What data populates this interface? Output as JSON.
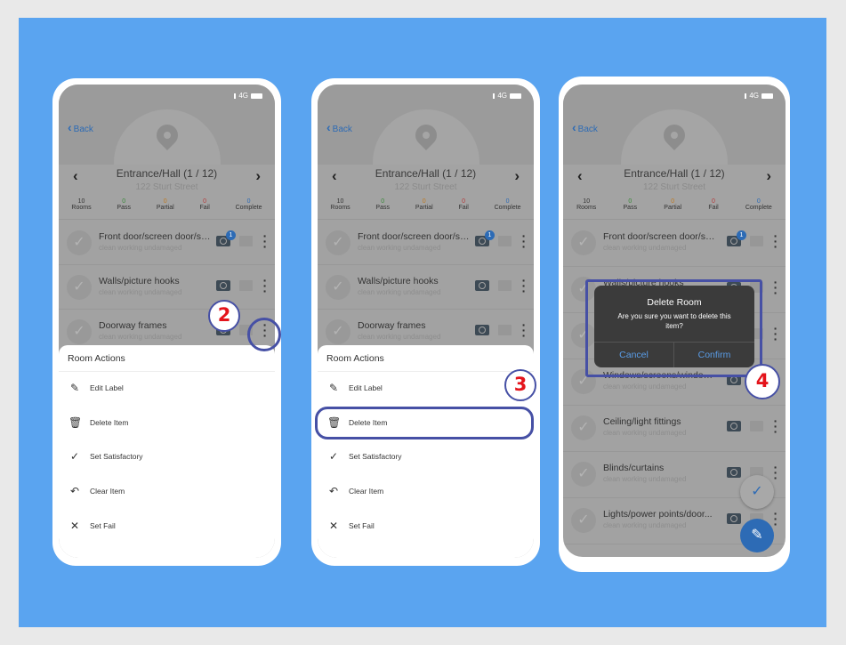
{
  "status": {
    "network": "4G"
  },
  "header": {
    "back_label": "Back",
    "title": "Entrance/Hall (1 / 12)",
    "address": "122 Sturt Street",
    "prev_icon": "chevron-left",
    "next_icon": "chevron-right"
  },
  "stats": [
    {
      "value": "10",
      "label": "Rooms",
      "color": "#333333"
    },
    {
      "value": "0",
      "label": "Pass",
      "color": "#3a8a3a"
    },
    {
      "value": "0",
      "label": "Partial",
      "color": "#c07a20"
    },
    {
      "value": "0",
      "label": "Fail",
      "color": "#b53a3a"
    },
    {
      "value": "0",
      "label": "Complete",
      "color": "#2d6bb5"
    }
  ],
  "items": [
    {
      "title": "Front door/screen door/se...",
      "subtitle": "clean working undamaged",
      "photo_count": "1"
    },
    {
      "title": "Walls/picture hooks",
      "subtitle": "clean working undamaged"
    },
    {
      "title": "Doorway frames",
      "subtitle": "clean working undamaged"
    },
    {
      "title": "Windows/screens/window...",
      "subtitle": "clean working undamaged"
    },
    {
      "title": "Ceiling/light fittings",
      "subtitle": "clean working undamaged"
    },
    {
      "title": "Blinds/curtains",
      "subtitle": "clean working undamaged"
    },
    {
      "title": "Lights/power points/door...",
      "subtitle": "clean working undamaged"
    }
  ],
  "room_actions": {
    "title": "Room Actions",
    "items": [
      {
        "label": "Edit Label",
        "icon": "pencil-icon",
        "glyph": "✎"
      },
      {
        "label": "Delete Item",
        "icon": "trash-icon",
        "glyph": "🗑"
      },
      {
        "label": "Set Satisfactory",
        "icon": "check-icon",
        "glyph": "✓"
      },
      {
        "label": "Clear Item",
        "icon": "undo-icon",
        "glyph": "↶"
      },
      {
        "label": "Set Fail",
        "icon": "close-icon",
        "glyph": "✕"
      }
    ]
  },
  "dialog": {
    "title": "Delete Room",
    "message": "Are you sure you want to delete this item?",
    "cancel": "Cancel",
    "confirm": "Confirm"
  },
  "steps": [
    "2",
    "3",
    "4"
  ],
  "colors": {
    "background": "#5aa4f0",
    "accent": "#2d6bb5",
    "annotation": "#4650a5",
    "step_number": "#e4141b"
  }
}
